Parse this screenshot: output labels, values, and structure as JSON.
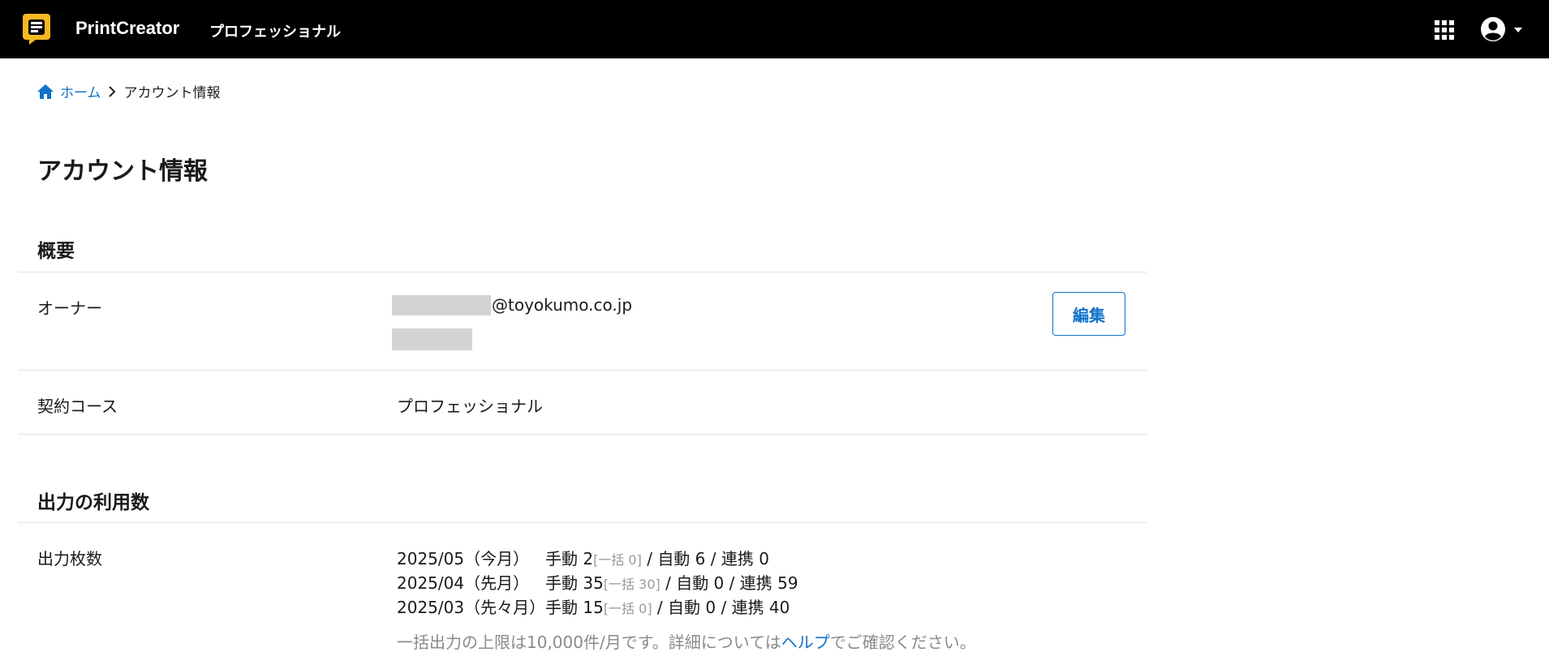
{
  "header": {
    "app_name": "PrintCreator",
    "plan_name": "プロフェッショナル",
    "brand_color": "#f6b922",
    "icons": [
      "apps-grid-icon",
      "account-circle-icon",
      "caret-down-icon"
    ]
  },
  "breadcrumb": {
    "home_label": "ホーム",
    "current_label": "アカウント情報"
  },
  "page": {
    "title": "アカウント情報"
  },
  "overview": {
    "section_title": "概要",
    "owner_label": "オーナー",
    "owner_email_domain": "@toyokumo.co.jp",
    "edit_label": "編集",
    "contract_label": "契約コース",
    "contract_value": "プロフェッショナル"
  },
  "usage": {
    "section_title": "出力の利用数",
    "label": "出力枚数",
    "rows": [
      {
        "month": "2025/05（今月）",
        "manual": "手動 2",
        "bulk": "[一括 0]",
        "rest": " / 自動 6 / 連携 0"
      },
      {
        "month": "2025/04（先月）",
        "manual": "手動 35",
        "bulk": "[一括 30]",
        "rest": " / 自動 0 / 連携 59"
      },
      {
        "month": "2025/03（先々月）",
        "manual": "手動 15",
        "bulk": "[一括 0]",
        "rest": " / 自動 0 / 連携 40"
      }
    ],
    "note_before": "一括出力の上限は10,000件/月です。詳細については",
    "note_link": "ヘルプ",
    "note_after": "でご確認ください。"
  },
  "colors": {
    "topbar": "#000000",
    "link": "#1272c9",
    "divider": "#e2e2e2"
  }
}
